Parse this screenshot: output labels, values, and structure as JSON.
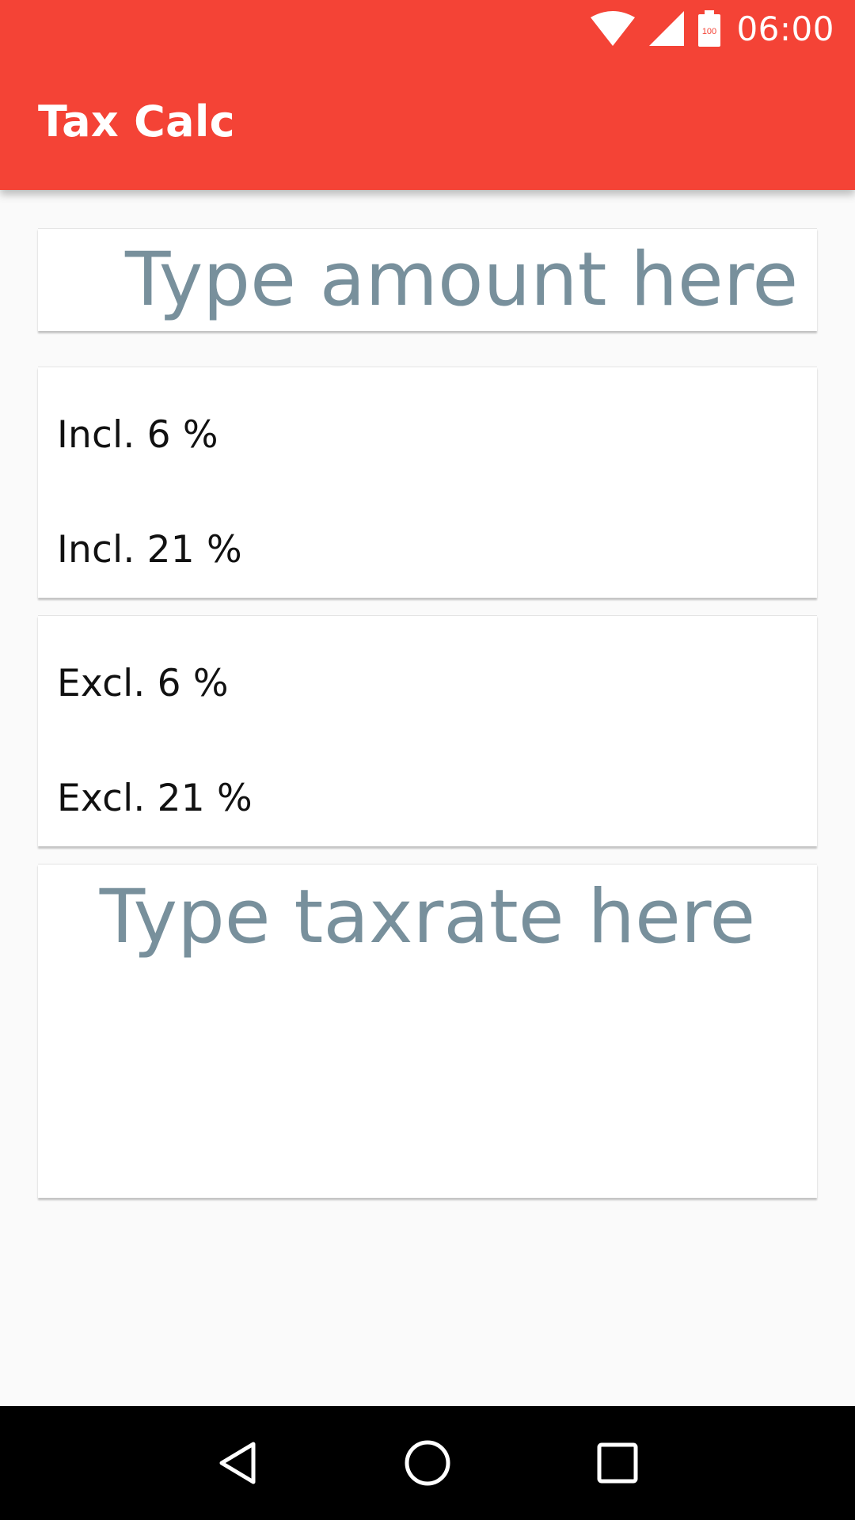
{
  "status_bar": {
    "time": "06:00",
    "battery_level": "100",
    "icons": [
      "wifi-icon",
      "cell-signal-icon",
      "battery-icon"
    ]
  },
  "app_bar": {
    "title": "Tax Calc",
    "color": "#f44336"
  },
  "amount_input": {
    "placeholder": "Type amount here",
    "value": ""
  },
  "incl_list": {
    "items": [
      {
        "label": "Incl. 6 %"
      },
      {
        "label": "Incl. 21 %"
      }
    ]
  },
  "excl_list": {
    "items": [
      {
        "label": "Excl. 6 %"
      },
      {
        "label": "Excl. 21 %"
      }
    ]
  },
  "taxrate_input": {
    "placeholder": "Type taxrate here",
    "value": ""
  },
  "nav_bar": {
    "buttons": [
      "back-icon",
      "home-icon",
      "recents-icon"
    ]
  },
  "colors": {
    "accent": "#f44336",
    "placeholder": "#78909c",
    "background": "#fafafa"
  }
}
